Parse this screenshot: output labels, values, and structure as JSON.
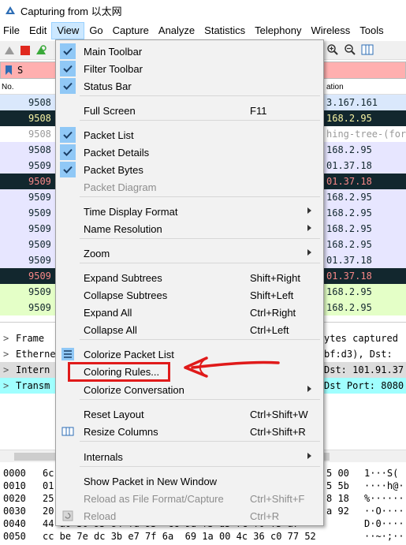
{
  "window": {
    "title": "Capturing from 以太网"
  },
  "menubar": {
    "items": [
      "File",
      "Edit",
      "View",
      "Go",
      "Capture",
      "Analyze",
      "Statistics",
      "Telephony",
      "Wireless",
      "Tools"
    ]
  },
  "filter": {
    "value": "S"
  },
  "packet_list": {
    "header_no": "No.",
    "header_dst": "ation",
    "rows": [
      {
        "no": "9508",
        "dst": "3.167.161",
        "bg": "#dae8fc",
        "fg": "#12272e"
      },
      {
        "no": "9508",
        "dst": "168.2.95",
        "bg": "#12272e",
        "fg": "#f7f3a3"
      },
      {
        "no": "9508",
        "dst": "hing-tree-(for",
        "bg": "#ffffff",
        "fg": "#999999"
      },
      {
        "no": "9508",
        "dst": "168.2.95",
        "bg": "#e7e6ff",
        "fg": "#12272e"
      },
      {
        "no": "9509",
        "dst": "01.37.18",
        "bg": "#e7e6ff",
        "fg": "#12272e"
      },
      {
        "no": "9509",
        "dst": "01.37.18",
        "bg": "#12272e",
        "fg": "#f78787"
      },
      {
        "no": "9509",
        "dst": "168.2.95",
        "bg": "#e7e6ff",
        "fg": "#12272e"
      },
      {
        "no": "9509",
        "dst": "168.2.95",
        "bg": "#e7e6ff",
        "fg": "#12272e"
      },
      {
        "no": "9509",
        "dst": "168.2.95",
        "bg": "#e7e6ff",
        "fg": "#12272e"
      },
      {
        "no": "9509",
        "dst": "168.2.95",
        "bg": "#e7e6ff",
        "fg": "#12272e"
      },
      {
        "no": "9509",
        "dst": "01.37.18",
        "bg": "#e7e6ff",
        "fg": "#12272e"
      },
      {
        "no": "9509",
        "dst": "01.37.18",
        "bg": "#12272e",
        "fg": "#f78787"
      },
      {
        "no": "9509",
        "dst": "168.2.95",
        "bg": "#e4ffc7",
        "fg": "#12272e"
      },
      {
        "no": "9509",
        "dst": "168.2.95",
        "bg": "#e4ffc7",
        "fg": "#12272e"
      }
    ]
  },
  "details": {
    "rows": [
      {
        "label": "Frame",
        "right": "ytes captured",
        "bg": "#ffffff"
      },
      {
        "label": "Etherne",
        "right": "bf:d3), Dst:",
        "bg": "#ffffff"
      },
      {
        "label": "Intern",
        "right": "Dst: 101.91.37",
        "bg": "#dddddd"
      },
      {
        "label": "Transm",
        "right": "Dst Port: 8080",
        "bg": "#a0ffff"
      }
    ]
  },
  "bytes": {
    "rows": [
      {
        "off": "0000",
        "hex": "6c",
        "hexr": "5 00",
        "asc": "1···S("
      },
      {
        "off": "0010",
        "hex": "01",
        "hexr": "5 5b",
        "asc": "····h@·"
      },
      {
        "off": "0020",
        "hex": "25",
        "hexr": "8 18",
        "asc": "%······"
      },
      {
        "off": "0030",
        "hex": "20",
        "hexr": "a 92",
        "asc": "··O····"
      },
      {
        "off": "0040",
        "hex": "44 a0 30 95 84 fd 93  cc 9d f3 d5 7c f0 f5 a7",
        "hexr": "",
        "asc": "D·0····"
      },
      {
        "off": "0050",
        "hex": "cc be 7e dc 3b e7 7f 6a  69 1a 00 4c 36 c0 77 52",
        "hexr": "",
        "asc": "··~·;··"
      }
    ]
  },
  "view_menu": {
    "items": [
      {
        "label": "Main Toolbar",
        "checked": true
      },
      {
        "label": "Filter Toolbar",
        "checked": true
      },
      {
        "label": "Status Bar",
        "checked": true
      },
      {
        "sep": true
      },
      {
        "label": "Full Screen",
        "shortcut": "F11"
      },
      {
        "sep": true
      },
      {
        "label": "Packet List",
        "checked": true
      },
      {
        "label": "Packet Details",
        "checked": true
      },
      {
        "label": "Packet Bytes",
        "checked": true
      },
      {
        "label": "Packet Diagram",
        "disabled": true
      },
      {
        "sep": true
      },
      {
        "label": "Time Display Format",
        "submenu": true
      },
      {
        "label": "Name Resolution",
        "submenu": true
      },
      {
        "sep": true
      },
      {
        "label": "Zoom",
        "submenu": true
      },
      {
        "sep": true
      },
      {
        "label": "Expand Subtrees",
        "shortcut": "Shift+Right"
      },
      {
        "label": "Collapse Subtrees",
        "shortcut": "Shift+Left"
      },
      {
        "label": "Expand All",
        "shortcut": "Ctrl+Right"
      },
      {
        "label": "Collapse All",
        "shortcut": "Ctrl+Left"
      },
      {
        "sep": true
      },
      {
        "label": "Colorize Packet List",
        "icon": "colorize-icon"
      },
      {
        "label": "Coloring Rules...",
        "highlighted_annotation": true
      },
      {
        "label": "Colorize Conversation",
        "submenu": true
      },
      {
        "sep": true
      },
      {
        "label": "Reset Layout",
        "shortcut": "Ctrl+Shift+W"
      },
      {
        "label": "Resize Columns",
        "shortcut": "Ctrl+Shift+R",
        "icon": "resize-columns-icon"
      },
      {
        "sep": true
      },
      {
        "label": "Internals",
        "submenu": true
      },
      {
        "sep": true
      },
      {
        "label": "Show Packet in New Window"
      },
      {
        "label": "Reload as File Format/Capture",
        "shortcut": "Ctrl+Shift+F",
        "disabled": true
      },
      {
        "label": "Reload",
        "shortcut": "Ctrl+R",
        "disabled": true,
        "icon": "reload-icon"
      }
    ]
  },
  "colors": {
    "menu_active_bg": "#cce8ff",
    "check_bg": "#90c8f6",
    "annotation_red": "#e01a1a",
    "filter_invalid_bg": "#ffafaf"
  }
}
